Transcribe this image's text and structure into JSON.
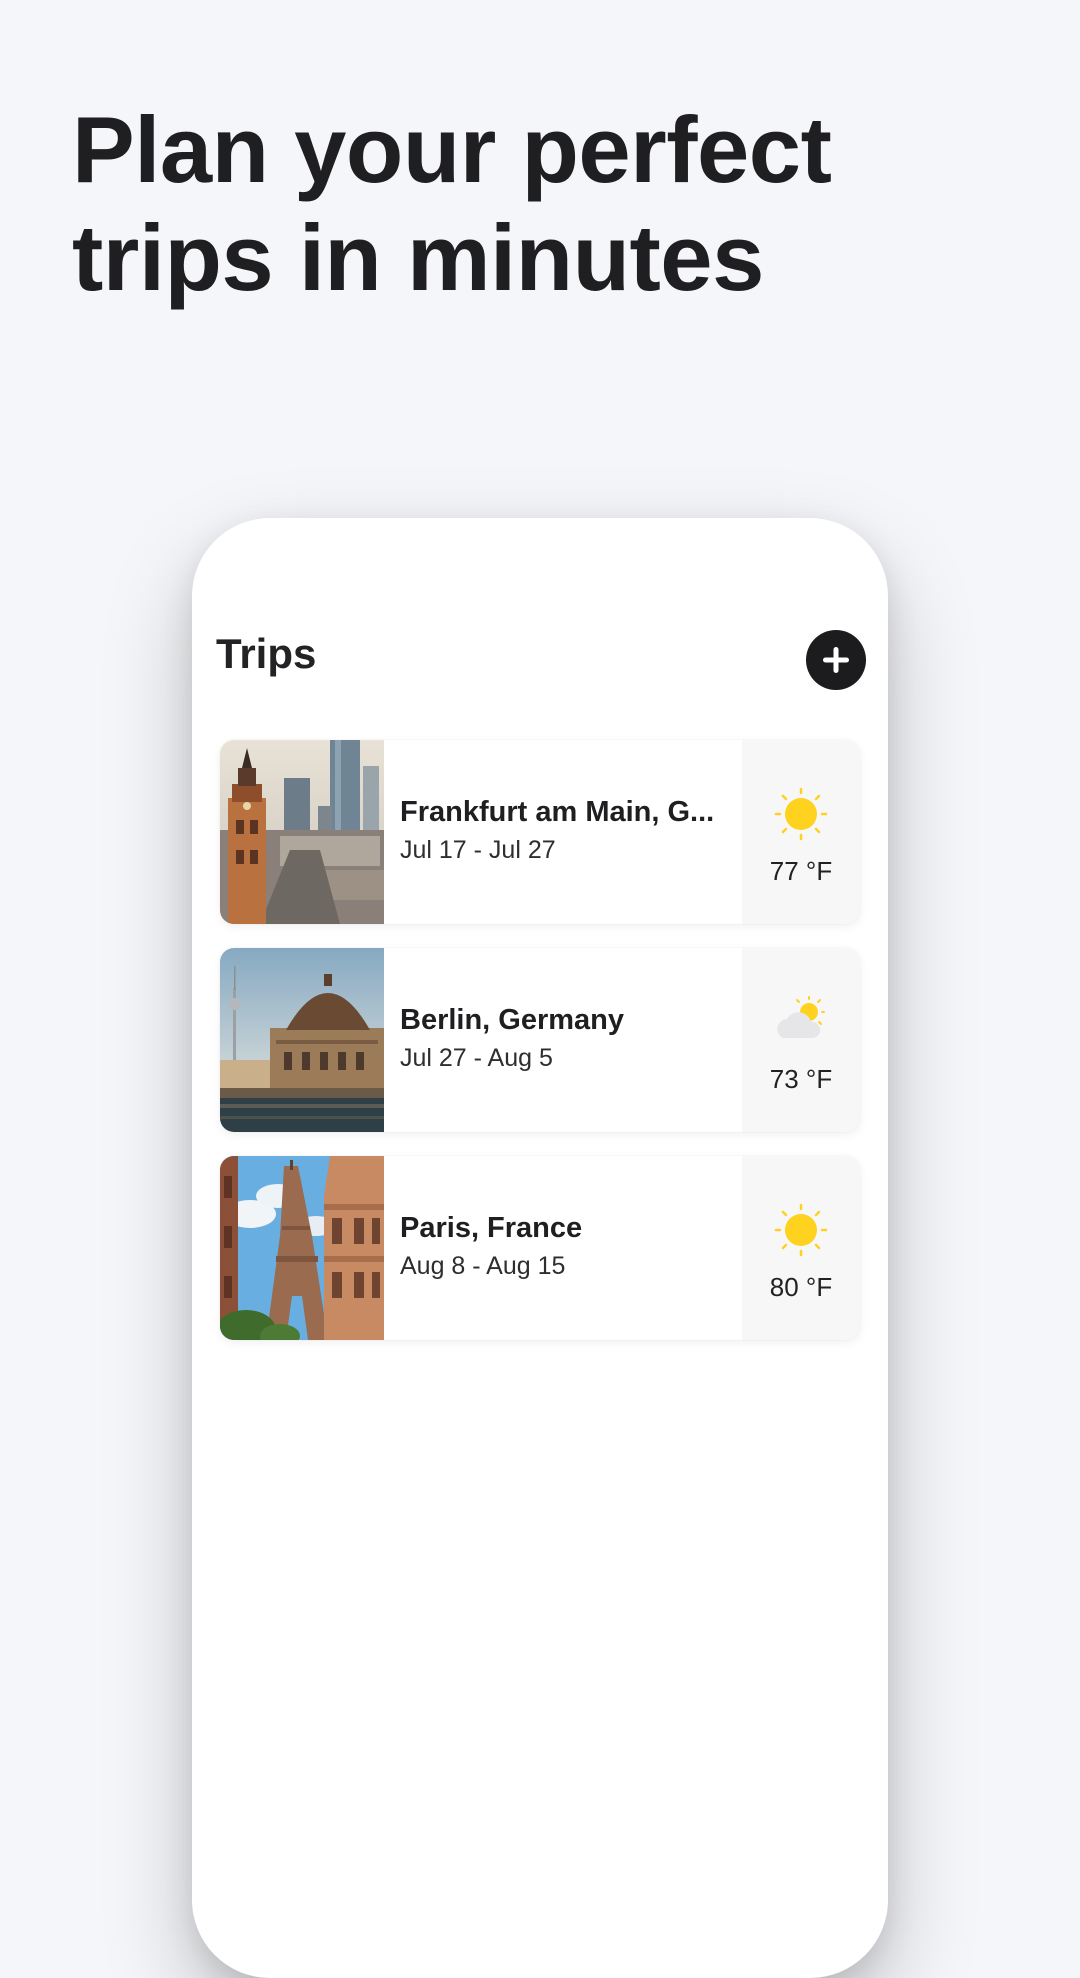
{
  "headline": {
    "line1": "Plan your perfect",
    "line2": "trips in minutes"
  },
  "screen": {
    "title": "Trips",
    "add_icon": "plus-circle-icon"
  },
  "trips": [
    {
      "city": "Frankfurt am Main, G...",
      "dates": "Jul 17 - Jul 27",
      "weather_icon": "sun-icon",
      "temperature": "77 °F"
    },
    {
      "city": "Berlin, Germany",
      "dates": "Jul 27 - Aug 5",
      "weather_icon": "partly-cloudy-icon",
      "temperature": "73 °F"
    },
    {
      "city": "Paris, France",
      "dates": "Aug 8 - Aug 15",
      "weather_icon": "sun-icon",
      "temperature": "80 °F"
    }
  ],
  "colors": {
    "background": "#f5f6f9",
    "text": "#1f1f21",
    "accent_button": "#1c1c1e",
    "sun": "#ffd21f"
  }
}
